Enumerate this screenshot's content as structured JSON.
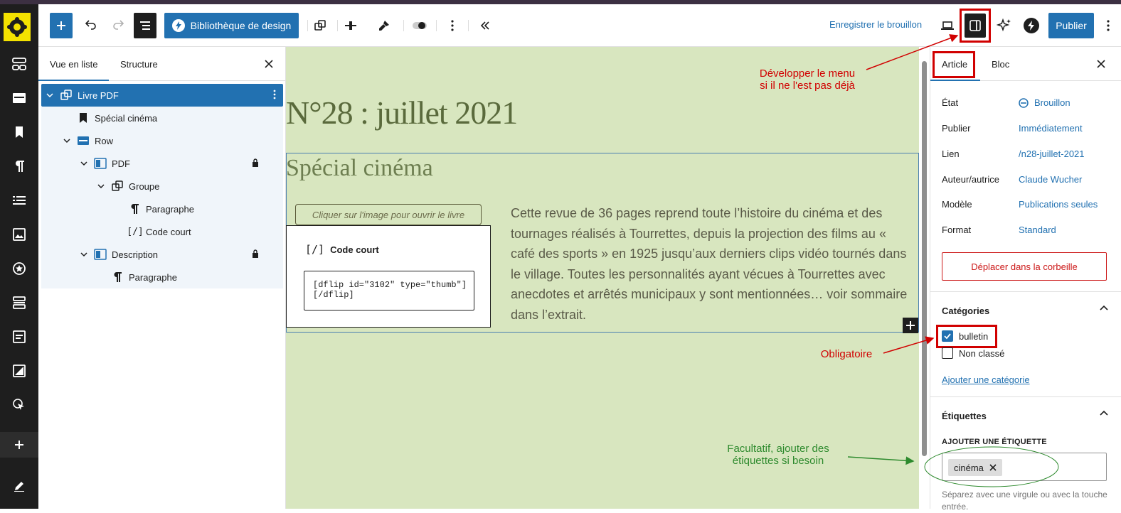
{
  "toolbar": {
    "design_library": "Bibliothèque de design",
    "save_draft": "Enregistrer le brouillon",
    "publish": "Publier"
  },
  "listview": {
    "tab_list": "Vue en liste",
    "tab_structure": "Structure",
    "items": [
      {
        "label": "Livre PDF"
      },
      {
        "label": "Spécial cinéma"
      },
      {
        "label": "Row"
      },
      {
        "label": "PDF"
      },
      {
        "label": "Groupe"
      },
      {
        "label": "Paragraphe"
      },
      {
        "label": "Code court"
      },
      {
        "label": "Description"
      },
      {
        "label": "Paragraphe"
      }
    ]
  },
  "canvas": {
    "title": "N°28 : juillet 2021",
    "heading": "Spécial cinéma",
    "button_text": "Cliquer sur l'image pour ouvrir le livre",
    "shortcode_label": "Code court",
    "shortcode_value": "[dflip id=\"3102\" type=\"thumb\"]\n[/dflip]",
    "description": "Cette revue de 36 pages reprend toute l’histoire du cinéma et des tournages réalisés à Tourrettes, depuis la projection des films au « café des sports » en 1925 jusqu’aux derniers clips vidéo tournés dans le village. Toutes les personnalités ayant vécues à Tourrettes avec anecdotes et arrêtés municipaux y sont mentionnées… voir sommaire dans l’extrait."
  },
  "sidebar": {
    "tab_article": "Article",
    "tab_block": "Bloc",
    "fields": [
      {
        "key": "État",
        "value": "Brouillon"
      },
      {
        "key": "Publier",
        "value": "Immédiatement"
      },
      {
        "key": "Lien",
        "value": "/n28-juillet-2021"
      },
      {
        "key": "Auteur/autrice",
        "value": "Claude Wucher"
      },
      {
        "key": "Modèle",
        "value": "Publications seules"
      },
      {
        "key": "Format",
        "value": "Standard"
      }
    ],
    "trash": "Déplacer dans la corbeille",
    "categories_title": "Catégories",
    "categories": [
      {
        "label": "bulletin",
        "checked": true
      },
      {
        "label": "Non classé",
        "checked": false
      }
    ],
    "add_category": "Ajouter une catégorie",
    "tags_title": "Étiquettes",
    "add_tag_label": "Ajouter une étiquette",
    "tag_chip": "cinéma",
    "tags_help": "Séparez avec une virgule ou avec la touche entrée."
  },
  "annotations": {
    "develop_menu_line1": "Développer le menu",
    "develop_menu_line2": "si il ne l'est pas déjà",
    "required": "Obligatoire",
    "optional_line1": "Facultatif, ajouter des",
    "optional_line2": "étiquettes si besoin"
  },
  "colors": {
    "accent": "#2271b1",
    "canvas_bg": "#d8e6bf",
    "annotation_red": "#d10000",
    "annotation_green": "#2d8a2d"
  }
}
